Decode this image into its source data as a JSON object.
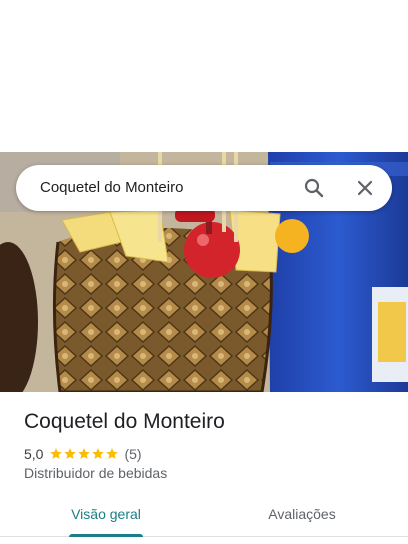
{
  "search": {
    "query": "Coquetel do Monteiro",
    "search_icon": "search-icon",
    "close_icon": "close-icon"
  },
  "hero_photo": "pineapple-cocktail-photo",
  "place": {
    "name": "Coquetel do Monteiro",
    "rating": "5,0",
    "stars": 5,
    "review_count": "(5)",
    "category": "Distribuidor de bebidas"
  },
  "tabs": [
    {
      "label": "Visão geral",
      "active": true
    },
    {
      "label": "Avaliações",
      "active": false
    }
  ],
  "colors": {
    "accent": "#1a7e88",
    "star": "#fbbc04",
    "text_primary": "#202124",
    "text_secondary": "#5f6368"
  }
}
